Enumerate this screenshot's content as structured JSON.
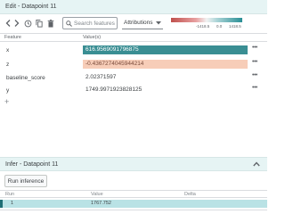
{
  "edit": {
    "title": "Edit - Datapoint 11",
    "search_placeholder": "Search features",
    "mode_select": "Attributions",
    "legend": {
      "min": "-1418.5",
      "mid": "0.0",
      "max": "1418.5"
    },
    "columns": {
      "feature": "Feature",
      "value": "Value(s)"
    },
    "rows": [
      {
        "feature": "x",
        "value": "616.9569091796875",
        "style": "positive"
      },
      {
        "feature": "z",
        "value": "-0.4367274045944214",
        "style": "negative"
      },
      {
        "feature": "baseline_score",
        "value": "2.02371597",
        "style": "plain"
      },
      {
        "feature": "y",
        "value": "1749.9971923828125",
        "style": "plain"
      }
    ],
    "more_label": "•••",
    "add_label": "+"
  },
  "infer": {
    "title": "Infer - Datapoint 11",
    "run_label": "Run inference",
    "columns": {
      "run": "Run",
      "value": "Value",
      "delta": "Delta"
    },
    "rows": [
      {
        "run": "1",
        "value": "1767.752",
        "delta": ""
      }
    ]
  },
  "colors": {
    "header_bg": "#e6f4f4",
    "positive": "#3a8e93",
    "negative": "#f7cdb8",
    "result_row": "#b9e2e5"
  }
}
